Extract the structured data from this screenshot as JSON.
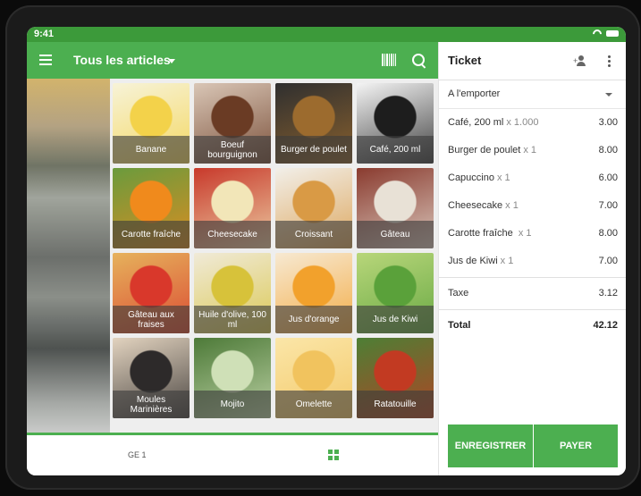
{
  "status": {
    "time": "9:41"
  },
  "header": {
    "title": "Tous les articles"
  },
  "items": [
    {
      "label": "Banane",
      "color1": "#f3d24a",
      "color2": "#f7f3d8"
    },
    {
      "label": "Boeuf bourguignon",
      "color1": "#6a3b24",
      "color2": "#d9c6b6"
    },
    {
      "label": "Burger de poulet",
      "color1": "#9c6b2e",
      "color2": "#2f2f2f"
    },
    {
      "label": "Café, 200 ml",
      "color1": "#1d1d1d",
      "color2": "#f4f4f4"
    },
    {
      "label": "Carotte fraîche",
      "color1": "#f08a1c",
      "color2": "#6a9b3d"
    },
    {
      "label": "Cheesecake",
      "color1": "#f2e6b8",
      "color2": "#c8392b"
    },
    {
      "label": "Croissant",
      "color1": "#d99a45",
      "color2": "#f2efe9"
    },
    {
      "label": "Gâteau",
      "color1": "#e8e1d6",
      "color2": "#8a3b2f"
    },
    {
      "label": "Gâteau aux fraises",
      "color1": "#d9382b",
      "color2": "#e6b25c"
    },
    {
      "label": "Huile d'olive, 100 ml",
      "color1": "#d7c23a",
      "color2": "#f0ead8"
    },
    {
      "label": "Jus d'orange",
      "color1": "#f2a12c",
      "color2": "#f7e9d2"
    },
    {
      "label": "Jus de Kiwi",
      "color1": "#5aa13a",
      "color2": "#b8d67a"
    },
    {
      "label": "Moules Marinières",
      "color1": "#2d2a2a",
      "color2": "#e2d3bf"
    },
    {
      "label": "Mojito",
      "color1": "#cfe0b7",
      "color2": "#4d7a38"
    },
    {
      "label": "Omelette",
      "color1": "#f1c35e",
      "color2": "#fbe6a8"
    },
    {
      "label": "Ratatouille",
      "color1": "#c23a22",
      "color2": "#4d7f35"
    }
  ],
  "bottom": {
    "page_label": "GE 1"
  },
  "ticket": {
    "title": "Ticket",
    "dining_option": "A l'emporter",
    "lines": [
      {
        "name": "Café, 200 ml",
        "qty": "x 1.000",
        "price": "3.00"
      },
      {
        "name": "Burger de poulet",
        "qty": "x 1",
        "price": "8.00"
      },
      {
        "name": "Capuccino",
        "qty": "x 1",
        "price": "6.00"
      },
      {
        "name": "Cheesecake",
        "qty": "x 1",
        "price": "7.00"
      },
      {
        "name": "Carotte fraîche ",
        "qty": "x 1",
        "price": "8.00"
      },
      {
        "name": "Jus de Kiwi",
        "qty": "x 1",
        "price": "7.00"
      }
    ],
    "tax_label": "Taxe",
    "tax_value": "3.12",
    "total_label": "Total",
    "total_value": "42.12",
    "save_label": "ENREGISTRER",
    "pay_label": "PAYER"
  },
  "colors": {
    "accent": "#4caf50",
    "accent_dark": "#3c9a3a"
  }
}
